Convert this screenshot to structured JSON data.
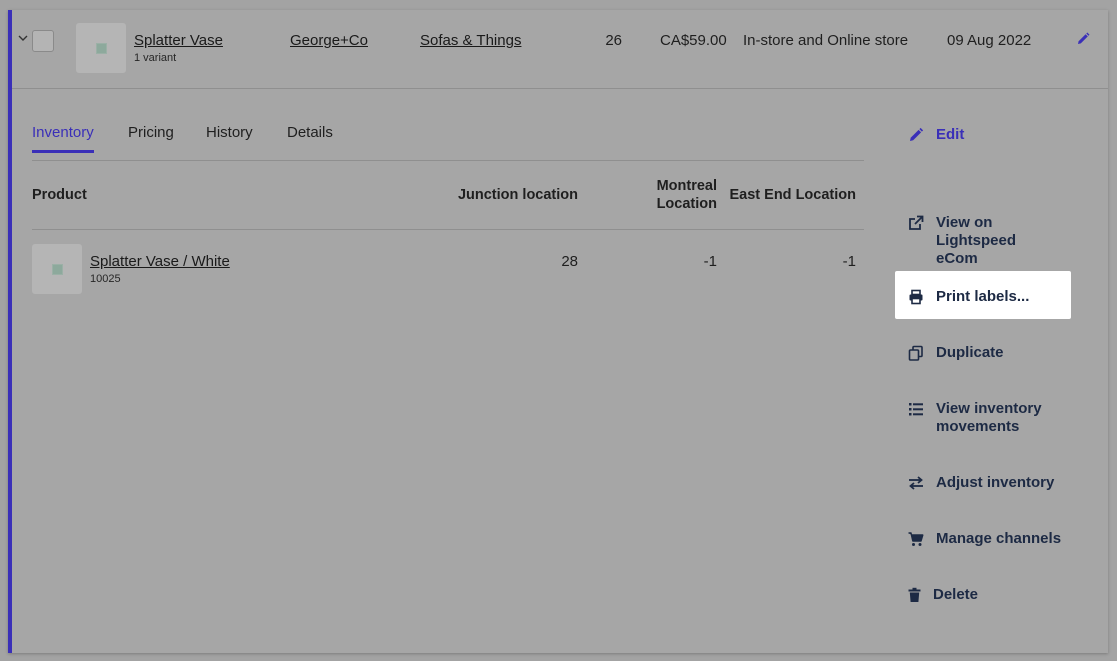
{
  "product_row": {
    "name": "Splatter Vase",
    "variants": "1 variant",
    "brand": "George+Co",
    "supplier": "Sofas & Things",
    "quantity": "26",
    "price": "CA$59.00",
    "channels": "In-store and Online store",
    "date": "09 Aug 2022"
  },
  "tabs": [
    {
      "label": "Inventory",
      "active": true
    },
    {
      "label": "Pricing",
      "active": false
    },
    {
      "label": "History",
      "active": false
    },
    {
      "label": "Details",
      "active": false
    }
  ],
  "table": {
    "headers": {
      "product": "Product",
      "junction": "Junction location",
      "montreal": "Montreal Location",
      "east_end": "East End Location"
    },
    "rows": [
      {
        "name": "Splatter Vase / White",
        "sku": "10025",
        "junction": "28",
        "montreal": "-1",
        "east_end": "-1"
      }
    ]
  },
  "actions": {
    "edit": "Edit",
    "view_ecom": "View on Lightspeed eCom",
    "print_labels": "Print labels...",
    "duplicate": "Duplicate",
    "inventory_movements": "View inventory movements",
    "adjust_inventory": "Adjust inventory",
    "manage_channels": "Manage channels",
    "delete": "Delete"
  },
  "colors": {
    "accent": "#3a2fb8",
    "action_text": "#1d2a44",
    "overlay_bg": "#a6a6a6",
    "highlight": "#ffffff"
  }
}
